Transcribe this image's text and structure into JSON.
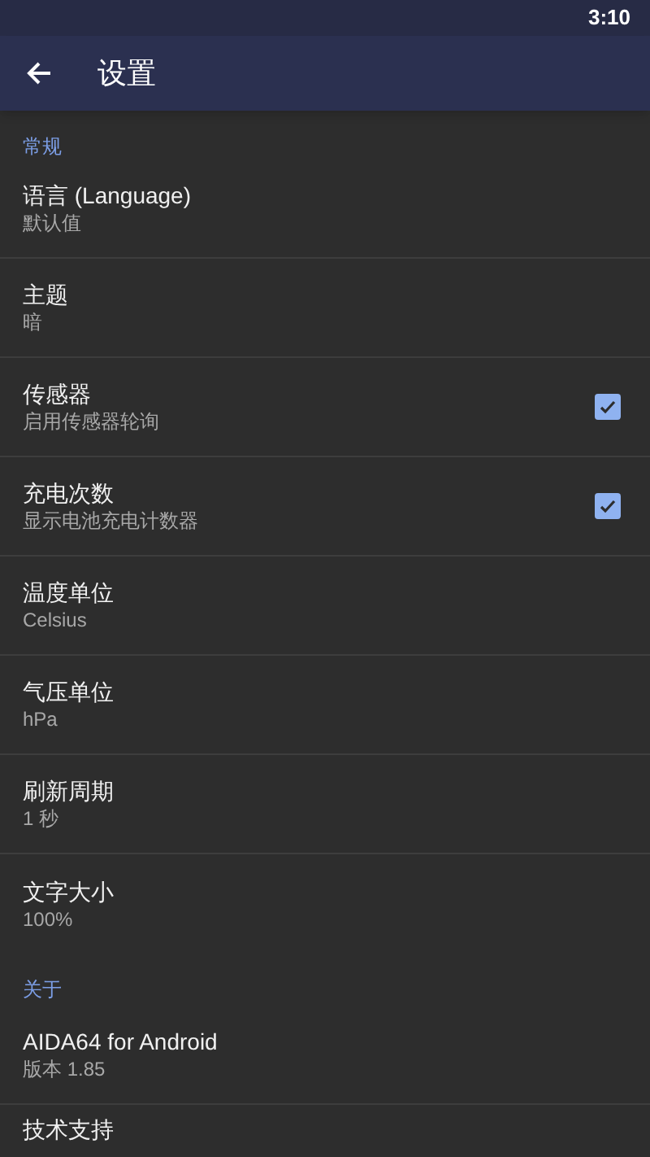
{
  "status_bar": {
    "time": "3:10"
  },
  "toolbar": {
    "title": "设置"
  },
  "sections": [
    {
      "header": "常规",
      "items": [
        {
          "kind": "text",
          "title": "语言 (Language)",
          "summary": "默认值"
        },
        {
          "kind": "text",
          "title": "主题",
          "summary": "暗"
        },
        {
          "kind": "checkbox",
          "title": "传感器",
          "summary": "启用传感器轮询",
          "checked": true
        },
        {
          "kind": "checkbox",
          "title": "充电次数",
          "summary": "显示电池充电计数器",
          "checked": true
        },
        {
          "kind": "text",
          "title": "温度单位",
          "summary": "Celsius"
        },
        {
          "kind": "text",
          "title": "气压单位",
          "summary": "hPa"
        },
        {
          "kind": "text",
          "title": "刷新周期",
          "summary": "1 秒"
        },
        {
          "kind": "text",
          "title": "文字大小",
          "summary": "100%"
        }
      ]
    },
    {
      "header": "关于",
      "items": [
        {
          "kind": "text",
          "title": "AIDA64 for Android",
          "summary": "版本 1.85"
        },
        {
          "kind": "text",
          "title": "技术支持"
        }
      ]
    }
  ]
}
